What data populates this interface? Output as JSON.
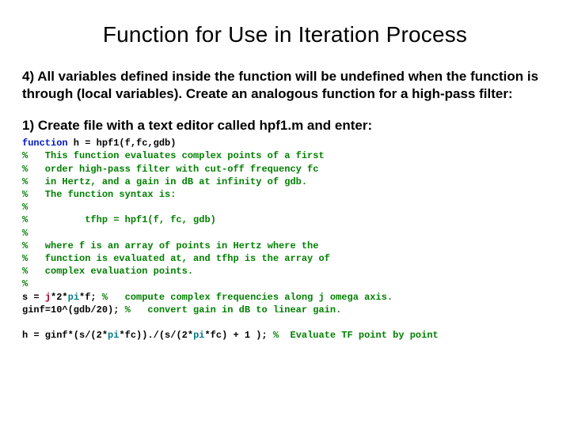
{
  "title": "Function for Use in Iteration Process",
  "para4": "4) All variables defined inside the function will be undefined when the function is through (local variables). Create an analogous function for a high-pass filter:",
  "step1": "1) Create file with a text editor called hpf1.m and enter:",
  "code": {
    "fn_kw": "function",
    "fn_sig": " h = hpf1(f,fc,gdb)",
    "c1": "%   This function evaluates complex points of a first",
    "c2": "%   order high-pass filter with cut-off frequency fc",
    "c3": "%   in Hertz, and a gain in dB at infinity of gdb.",
    "c4": "%   The function syntax is:",
    "c5": "%",
    "c6": "%          tfhp = hpf1(f, fc, gdb)",
    "c7": "%",
    "c8": "%   where f is an array of points in Hertz where the",
    "c9": "%   function is evaluated at, and tfhp is the array of",
    "c10": "%   complex evaluation points.",
    "c11": "%",
    "s_line_a": "s = ",
    "s_line_j": "j",
    "s_line_b": "*2*",
    "s_line_pi": "pi",
    "s_line_c": "*f; ",
    "s_line_cmt": "%   compute complex frequencies along j omega axis.",
    "g_line_a": "ginf=10^(gdb/20); ",
    "g_line_cmt": "%   convert gain in dB to linear gain.",
    "h_line_a": "h = ginf*(s/(2*",
    "h_line_pi1": "pi",
    "h_line_b": "*fc))./(s/(2*",
    "h_line_pi2": "pi",
    "h_line_c": "*fc) + 1 ); ",
    "h_line_cmt": "%  Evaluate TF point by point"
  }
}
